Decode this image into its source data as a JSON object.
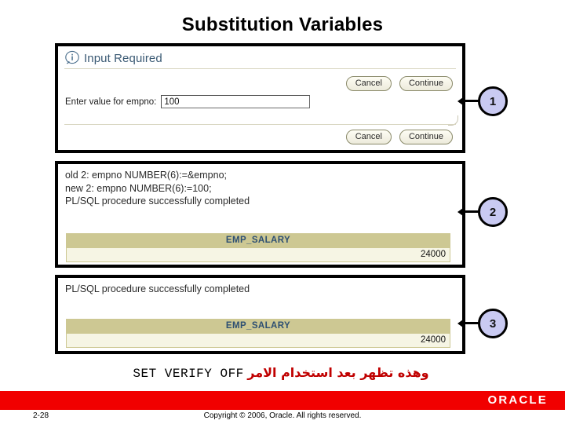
{
  "slide": {
    "title": "Substitution Variables"
  },
  "panel1": {
    "icon": "info-icon",
    "dialog_title": "Input Required",
    "field_label": "Enter value for empno:",
    "field_value": "100",
    "buttons_top": [
      "Cancel",
      "Continue"
    ],
    "buttons_bottom": [
      "Cancel",
      "Continue"
    ]
  },
  "panel2": {
    "console_text": "old 2: empno NUMBER(6):=&empno;\nnew 2: empno NUMBER(6):=100;\nPL/SQL procedure successfully completed",
    "grid": {
      "header": "EMP_SALARY",
      "value": "24000"
    }
  },
  "panel3": {
    "console_text": "PL/SQL procedure successfully completed",
    "grid": {
      "header": "EMP_SALARY",
      "value": "24000"
    }
  },
  "callouts": [
    {
      "label": "1"
    },
    {
      "label": "2"
    },
    {
      "label": "3"
    }
  ],
  "annotation": {
    "code": "SET VERIFY OFF",
    "arabic": "وهذه تظهر بعد استخدام الامر"
  },
  "footer": {
    "logo": "ORACLE",
    "page_number": "2-28",
    "copyright": "Copyright © 2006, Oracle.  All rights reserved."
  },
  "colors": {
    "callout_fill": "#c9caf2",
    "grid_header": "#cdc893",
    "grid_row": "#f6f5e4",
    "footer_red": "#f10000",
    "annotation_red": "#c00000",
    "dialog_title": "#3b5a74"
  }
}
